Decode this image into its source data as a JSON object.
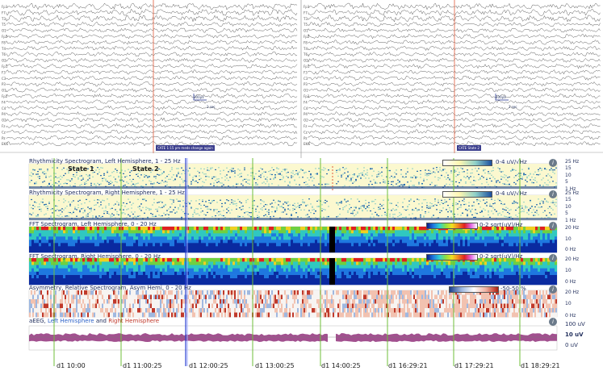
{
  "eeg": {
    "channels_left": [
      "Fp1",
      "F7",
      "T3",
      "T5",
      "O1",
      "Fp2",
      "F8",
      "T4",
      "T6",
      "O2",
      "Fp1",
      "F3",
      "C3",
      "P3",
      "O1",
      "Fp2",
      "F4",
      "C4",
      "P4",
      "O2",
      "Fz",
      "Cz",
      "Pz",
      "EKG"
    ],
    "channels_right": [
      "Fp1",
      "F7",
      "T3",
      "T5",
      "O1",
      "Fp2",
      "F8",
      "T4",
      "T6",
      "O2",
      "Fp1",
      "F3",
      "C3",
      "P3",
      "O1",
      "Fp2",
      "F4",
      "C4",
      "P4",
      "O2",
      "Fz",
      "Cz",
      "Pz",
      "EKG"
    ],
    "scale_label": "100μV",
    "scale_time": "1 sec",
    "note_left": "CATE 1:15 pm meds change again",
    "note_right": "CATE State 2"
  },
  "panels": [
    {
      "title": "Rhythmicity Spectrogram, Left Hemisphere, 1 - 25 Hz",
      "scale": "0-4 uV/√Hz",
      "ticks": [
        "25 Hz",
        "15",
        "10",
        "5",
        "1 Hz"
      ]
    },
    {
      "title": "Rhythmicity Spectrogram, Right Hemisphere, 1 - 25 Hz",
      "scale": "0-4 uV/√Hz",
      "ticks": [
        "25 Hz",
        "15",
        "10",
        "5",
        "1 Hz"
      ]
    },
    {
      "title": "FFT Spectrogram, Left Hemisphere, 0 - 20 Hz",
      "scale": "0-2 sqrt(uV)/Hz",
      "ticks": [
        "20 Hz",
        "10",
        "0 Hz"
      ]
    },
    {
      "title": "FFT Spectrogram, Right Hemisphere, 0 - 20 Hz",
      "scale": "0-2 sqrt(uV)/Hz",
      "ticks": [
        "20 Hz",
        "10",
        "0 Hz"
      ]
    },
    {
      "title": "Asymmetry, Relative Spectrogram, Asym Hemi, 0 - 20 Hz",
      "scale": "-50-50 %",
      "ticks": [
        "20 Hz",
        "10",
        "0 Hz"
      ]
    }
  ],
  "aeeg": {
    "title_prefix": "aEEG, ",
    "title_left": "Left Hemisphere",
    "title_and": " and ",
    "title_right": "Right Hemisphere",
    "ticks": [
      "100 uV",
      "10 uV",
      "0 uV"
    ]
  },
  "states": [
    "State 1",
    "State 2"
  ],
  "times": [
    "d1 10:00",
    "d1 11:00:25",
    "d1 12:00:25",
    "d1 13:00:25",
    "d1 14:00:25",
    "d1 16:29:21",
    "d1 17:29:21",
    "d1 18:29:21"
  ],
  "colors": {
    "accent_red": "#e05a3a",
    "marker_green": "#6fbf3a",
    "marker_blue": "#2a3fd1",
    "title_blue": "#23305e",
    "left_hemi": "#2f63c8",
    "right_hemi": "#c0392b",
    "aeeg_fill": "#a2508f"
  }
}
